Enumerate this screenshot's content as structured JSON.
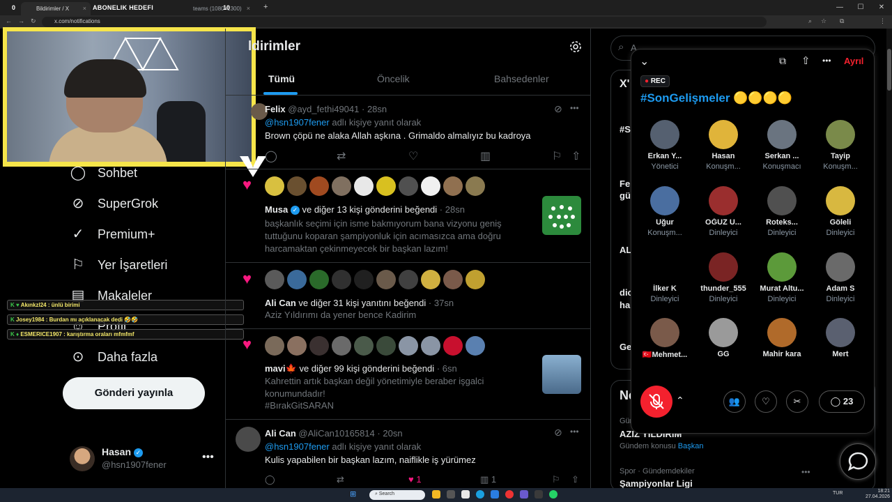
{
  "browser": {
    "tabs": [
      {
        "label": "Bildirimler / X"
      },
      {
        "label": "teams (1080×1300)"
      }
    ],
    "url": "x.com/notifications",
    "overlay_subscription_label": "ABONELIK HEDEFI",
    "overlay_subscription_count": "10",
    "overlay_zero": "0"
  },
  "sidebar": {
    "items": [
      {
        "label": "Sohbet",
        "icon": "chat-bubble-icon"
      },
      {
        "label": "SuperGrok",
        "icon": "grok-icon"
      },
      {
        "label": "Premium+",
        "icon": "premium-badge-icon"
      },
      {
        "label": "Yer İşaretleri",
        "icon": "bookmark-icon"
      },
      {
        "label": "Makaleler",
        "icon": "article-icon"
      },
      {
        "label": "Profil",
        "icon": "profile-icon"
      },
      {
        "label": "Daha fazla",
        "icon": "more-circle-icon"
      }
    ],
    "post_button": "Gönderi yayınla",
    "account": {
      "name": "Hasan",
      "handle": "@hsn1907fener"
    }
  },
  "chat_overlay": [
    {
      "user": "Akınkzl24",
      "text": "ünlü birimi"
    },
    {
      "user": "Josey1984",
      "text": "Burdan mı açıklanacak dedi 🤣🤣"
    },
    {
      "user": "ESMERICE1907",
      "text": "karıştırma oraları mfmfmf"
    }
  ],
  "notifications": {
    "title": "ldirimler",
    "tabs": [
      {
        "label": "Tümü"
      },
      {
        "label": "Öncelik"
      },
      {
        "label": "Bahsedenler"
      }
    ],
    "items": [
      {
        "type": "reply",
        "name": "Felix",
        "handle": "@ayd_fethi49041",
        "time": "28sn",
        "reply_to": "@hsn1907fener",
        "reply_suffix": "adlı kişiye yanıt olarak",
        "text": "Brown çöpü ne alaka Allah aşkına . Grimaldo almalıyız bu kadroya"
      },
      {
        "type": "like",
        "name": "Musa",
        "rest": "ve diğer 13 kişi gönderini beğendi",
        "time": "28sn",
        "text": "başkanlık seçimi için isme bakmıyorum bana vizyonu geniş tuttuğunu koparan şampiyonluk için acımasızca ama doğru harcamaktan çekinmeyecek bir başkan lazım!"
      },
      {
        "type": "like",
        "name": "Ali Can",
        "rest": "ve diğer 31 kişi yanıtını beğendi",
        "time": "37sn",
        "text": "Aziz Yıldırımı da yener bence Kadirim"
      },
      {
        "type": "like",
        "name": "mavi🍁",
        "rest": "ve diğer 99 kişi gönderini beğendi",
        "time": "6sn",
        "text": "Kahrettin artık başkan değil yönetimiyle beraber işgalci konumundadır!",
        "hashtag": "#BırakGitSARAN"
      },
      {
        "type": "reply",
        "name": "Ali Can",
        "handle": "@AliCan10165814",
        "time": "20sn",
        "reply_to": "@hsn1907fener",
        "reply_suffix": "adlı kişiye yanıt olarak",
        "text": "Kulis yapabilen bir başkan lazım, naiflikle iş yürümez",
        "likes": "1",
        "views": "1"
      }
    ]
  },
  "space": {
    "rec": "REC",
    "title": "#SonGelişmeler 🟡🟡🟡🟡",
    "leave": "Ayrıl",
    "speakers": [
      {
        "name": "Erkan Y...",
        "role": "Yönetici",
        "color": "#556070"
      },
      {
        "name": "Hasan",
        "role": "Konuşm...",
        "color": "#e0b43a"
      },
      {
        "name": "Serkan ...",
        "role": "Konuşmacı",
        "color": "#6a7480"
      },
      {
        "name": "Tayip",
        "role": "Konuşm...",
        "color": "#7a8a4a"
      },
      {
        "name": "Uğur",
        "role": "Konuşm...",
        "color": "#4a6ea0"
      },
      {
        "name": "OĞUZ U...",
        "role": "Dinleyici",
        "color": "#9a2e2e"
      },
      {
        "name": "Roteks...",
        "role": "Dinleyici",
        "color": "#505050"
      },
      {
        "name": "Göleli",
        "role": "Dinleyici",
        "color": "#d8b840"
      },
      {
        "name": "İlker K",
        "role": "Dinleyici",
        "color": "#000000"
      },
      {
        "name": "thunder_555",
        "role": "Dinleyici",
        "color": "#7a2424"
      },
      {
        "name": "Murat Altu...",
        "role": "Dinleyici",
        "color": "#5c9a3a"
      },
      {
        "name": "Adam S",
        "role": "Dinleyici",
        "color": "#6a6a6a"
      },
      {
        "name": "🇹🇷Mehmet...",
        "role": "",
        "color": "#7a5a4a"
      },
      {
        "name": "GG",
        "role": "",
        "color": "#9a9a9a"
      },
      {
        "name": "Mahir kara",
        "role": "",
        "color": "#b06a2a"
      },
      {
        "name": "Mert",
        "role": "",
        "color": "#5a6070"
      }
    ],
    "comment_count": "23"
  },
  "right_column": {
    "search_placeholder": "A",
    "trends_partial": [
      "X'",
      "#S",
      "Fe",
      "gü",
      "AL",
      "dic",
      "ha",
      "Ge"
    ],
    "news_header": "Ne",
    "trend1": {
      "category": "Gün",
      "title": "AZIZ YILDIRIM",
      "context": "Gündem konusu",
      "link": "Başkan"
    },
    "trend2": {
      "category": "Spor · Gündemdekiler",
      "title": "Şampiyonlar Ligi"
    }
  },
  "taskbar": {
    "search": "Search",
    "lang": "TUR",
    "time": "18:21",
    "date": "27.04.2026"
  },
  "colors": {
    "accent": "#1d9bf0",
    "like": "#f91880",
    "danger": "#f4212e",
    "cam_frame": "#f6e54a"
  }
}
